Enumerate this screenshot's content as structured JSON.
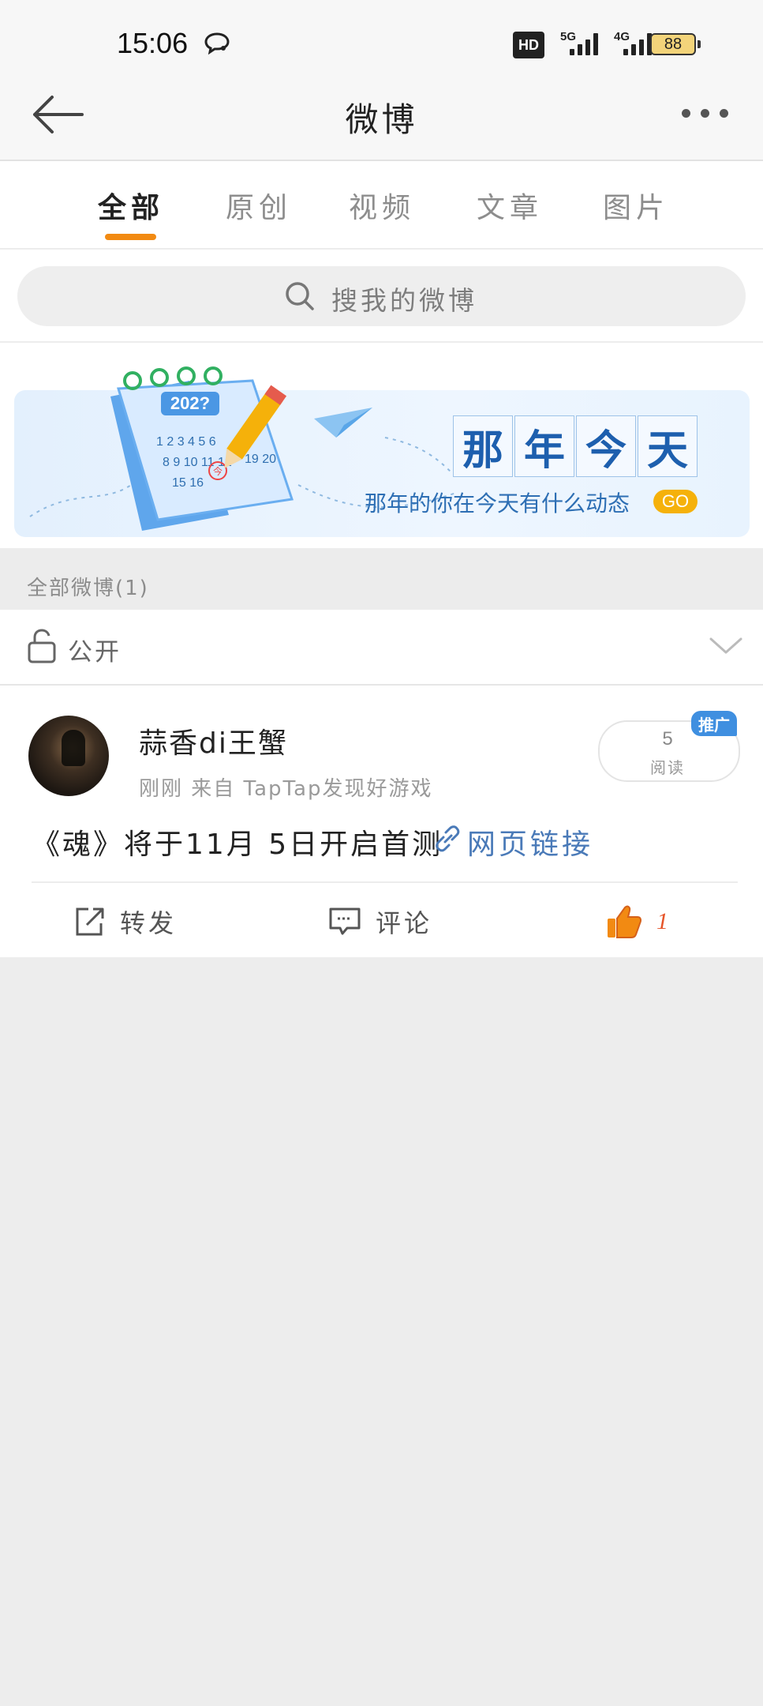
{
  "status_bar": {
    "time": "15:06",
    "network_5g": "5G",
    "network_4g": "4G",
    "hd_label": "HD",
    "battery": "88",
    "icons": [
      "chat-bubble-icon",
      "hd-icon",
      "signal-5g-icon",
      "signal-4g-icon",
      "battery-icon"
    ]
  },
  "header": {
    "title": "微博",
    "back_icon": "arrow-left-icon",
    "more_icon": "more-dots-icon"
  },
  "tabs": [
    {
      "label": "全部",
      "active": true
    },
    {
      "label": "原创",
      "active": false
    },
    {
      "label": "视频",
      "active": false
    },
    {
      "label": "文章",
      "active": false
    },
    {
      "label": "图片",
      "active": false
    }
  ],
  "search": {
    "placeholder": "搜我的微博"
  },
  "banner": {
    "title_chars": [
      "那",
      "年",
      "今",
      "天"
    ],
    "subtitle": "那年的你在今天有什么动态",
    "go_label": "GO",
    "calendar_year": "202?",
    "calendar_days_1": "1 2 3 4 5 6",
    "calendar_days_2": "8 9 10 11 12",
    "calendar_days_3": "15 16",
    "calendar_days_4": "19 20",
    "calendar_today": "今"
  },
  "section": {
    "label": "全部微博(1)"
  },
  "privacy": {
    "label": "公开"
  },
  "post": {
    "author": "蒜香di王蟹",
    "meta": "刚刚  来自 TapTap发现好游戏",
    "read_count": "5",
    "read_label": "阅读",
    "badge": "推广",
    "text": "《魂》将于11月 5日开启首测",
    "link_text": "网页链接",
    "actions": {
      "repost_label": "转发",
      "comment_label": "评论",
      "like_count": "1"
    }
  },
  "colors": {
    "accent": "#f28a12",
    "link": "#4a7ab8",
    "like": "#e6552a",
    "badge": "#3f8fe0",
    "page_bg": "#ededed"
  }
}
